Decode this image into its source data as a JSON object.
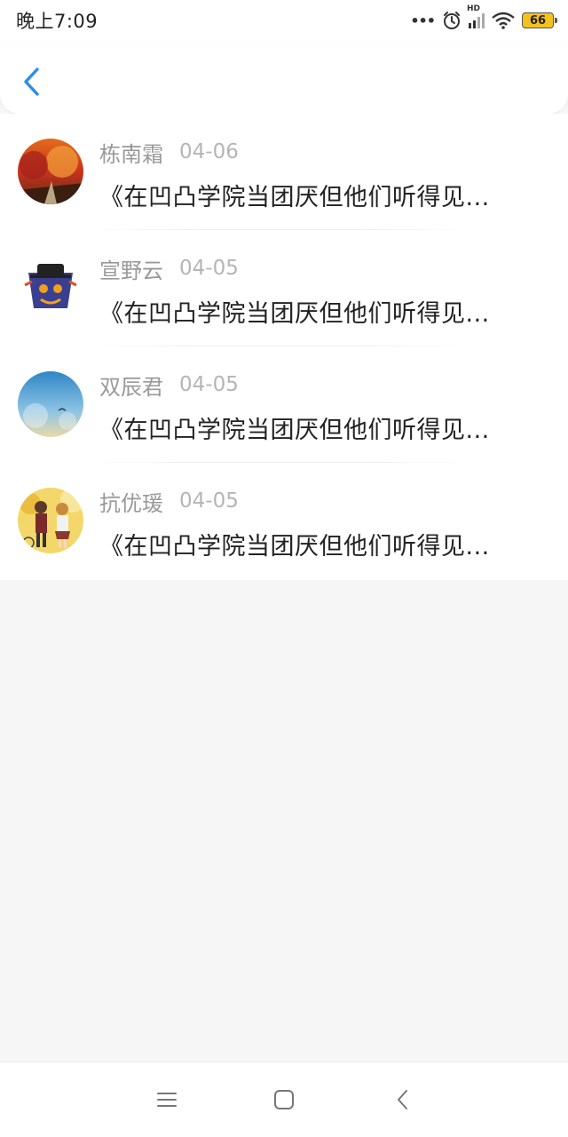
{
  "status_bar": {
    "time": "晚上7:09",
    "hd_label": "HD",
    "battery": "66",
    "icons": [
      "more-dots-icon",
      "alarm-icon",
      "signal-icon",
      "wifi-icon",
      "battery-icon"
    ]
  },
  "header": {
    "back_icon": "chevron-left-icon",
    "accent_color": "#2a8ee8"
  },
  "list": {
    "items": [
      {
        "name": "栋南霜",
        "date": "04-06",
        "title": "《在凹凸学院当团厌但他们听得见..."
      },
      {
        "name": "宣野云",
        "date": "04-05",
        "title": "《在凹凸学院当团厌但他们听得见..."
      },
      {
        "name": "双辰君",
        "date": "04-05",
        "title": "《在凹凸学院当团厌但他们听得见..."
      },
      {
        "name": "抗优瑗",
        "date": "04-05",
        "title": "《在凹凸学院当团厌但他们听得见..."
      }
    ]
  },
  "nav_bar": {
    "icons": [
      "menu-icon",
      "home-square-icon",
      "back-chevron-icon"
    ]
  }
}
